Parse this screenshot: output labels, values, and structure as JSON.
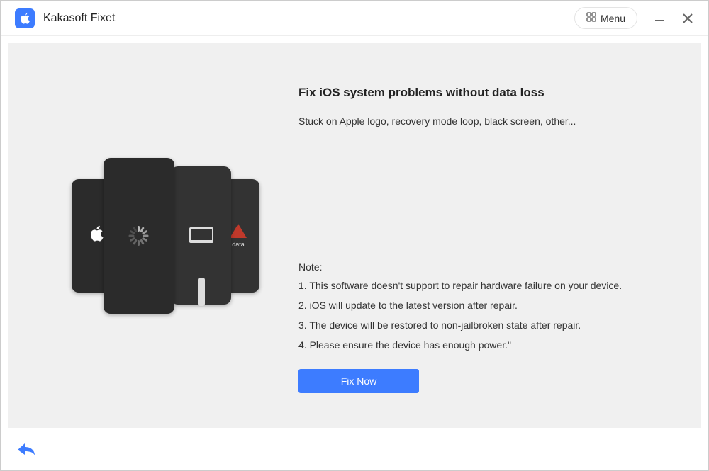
{
  "app": {
    "title": "Kakasoft Fixet"
  },
  "titlebar": {
    "menu_label": "Menu"
  },
  "main": {
    "heading": "Fix iOS system problems without data loss",
    "subheading": "Stuck on Apple logo, recovery mode loop, black screen, other...",
    "note_title": "Note:",
    "notes": [
      "1. This software doesn't support to repair hardware failure on your device.",
      "2. iOS will update to the latest version after repair.",
      "3. The device will be restored to non-jailbroken state after repair.",
      "4. Please ensure the device has enough power.\""
    ],
    "fix_button": "Fix Now"
  },
  "illustration": {
    "data_label": "data"
  }
}
